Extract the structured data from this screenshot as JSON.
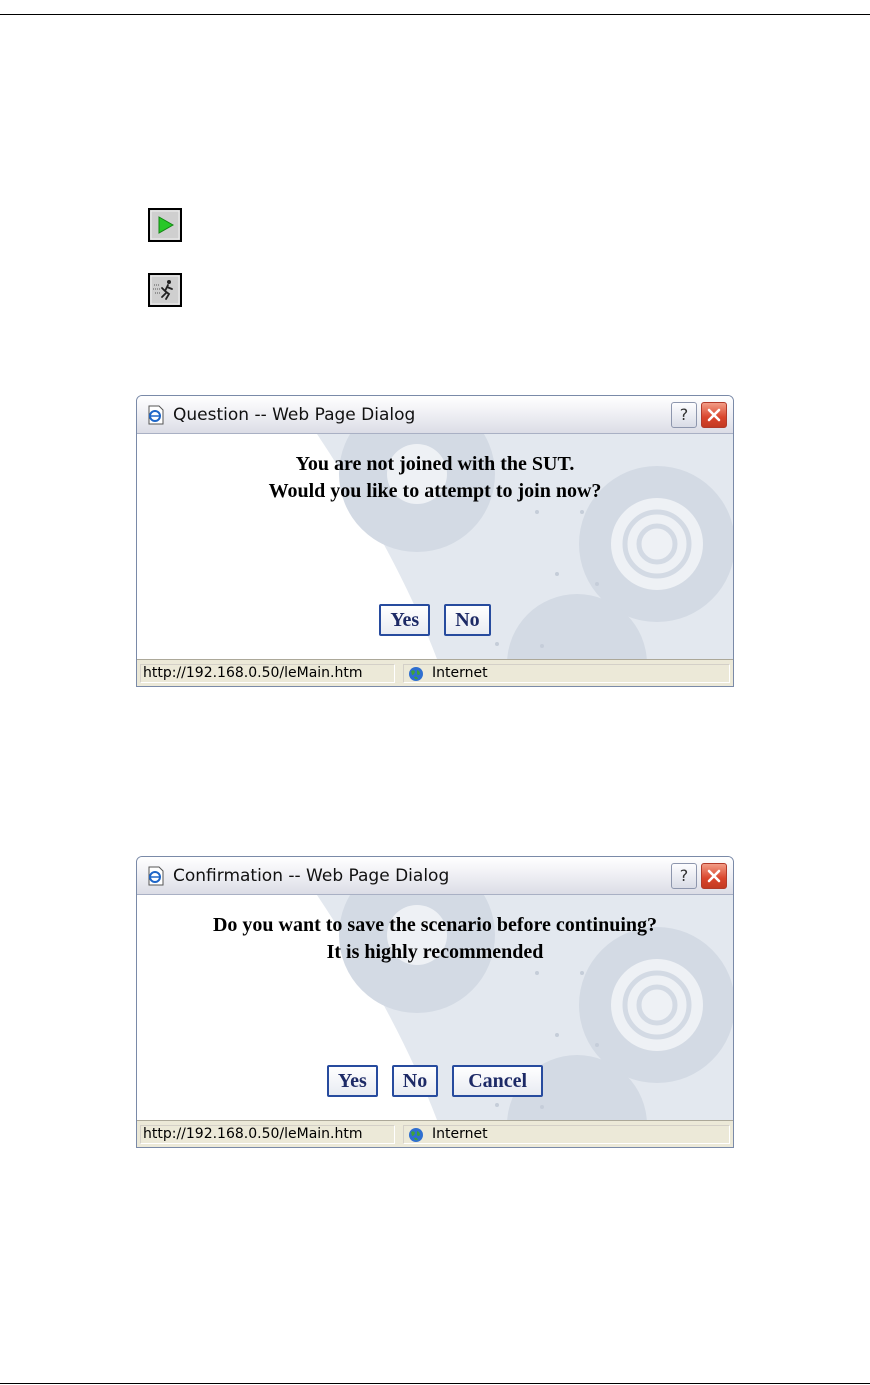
{
  "toolbar_icons": [
    {
      "icon": "play-icon",
      "color": "#28c828"
    },
    {
      "icon": "running-man-icon",
      "color": "#222222"
    }
  ],
  "dialogs": [
    {
      "title": "Question -- Web Page Dialog",
      "help_label": "?",
      "message": [
        "You are not joined with the SUT.",
        "Would you like to attempt to join now?"
      ],
      "buttons": [
        "Yes",
        "No"
      ],
      "status_url": "http://192.168.0.50/leMain.htm",
      "status_zone": "Internet"
    },
    {
      "title": "Confirmation -- Web Page Dialog",
      "help_label": "?",
      "message": [
        "Do you want to save the scenario before continuing?",
        "It is highly recommended"
      ],
      "buttons": [
        "Yes",
        "No",
        "Cancel"
      ],
      "status_url": "http://192.168.0.50/leMain.htm",
      "status_zone": "Internet"
    }
  ],
  "colors": {
    "button_border": "#274b9e",
    "button_text": "#1d2a66",
    "close_button": "#d9452c",
    "status_bar": "#ece9d8"
  }
}
